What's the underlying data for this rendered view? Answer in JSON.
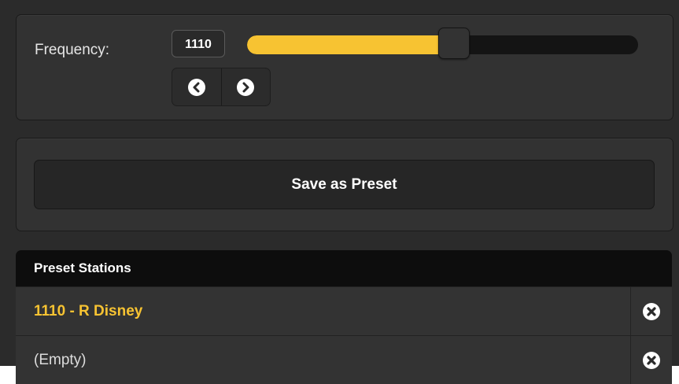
{
  "frequency": {
    "label": "Frequency:",
    "value": "1110",
    "slider_level": 0.53,
    "prev_icon": "chevron-left-circle-icon",
    "next_icon": "chevron-right-circle-icon"
  },
  "save": {
    "label": "Save as Preset"
  },
  "presets": {
    "header": "Preset Stations",
    "delete_icon": "close-circle-icon",
    "items": [
      {
        "label": "1110 - R Disney",
        "active": true
      },
      {
        "label": "(Empty)",
        "active": false
      }
    ]
  },
  "colors": {
    "accent": "#f7c332",
    "background": "#2b2b2b",
    "panel": "#323232",
    "header": "#0d0d0d"
  }
}
